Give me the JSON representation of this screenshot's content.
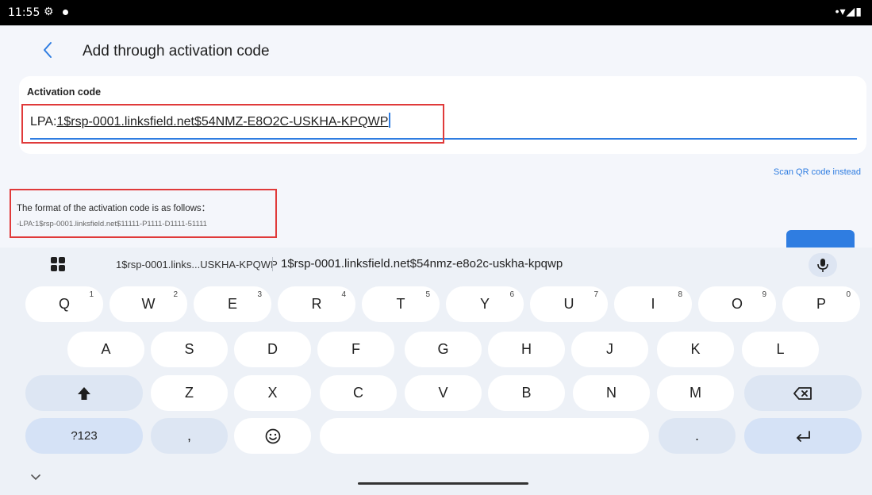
{
  "status_bar": {
    "time": "11:55",
    "settings_icon": "gear-icon",
    "right_icons": "•▾◢▮"
  },
  "header": {
    "title": "Add through activation code",
    "back_icon": "chevron-left-icon"
  },
  "activation": {
    "label": "Activation code",
    "prefix": "LPA:",
    "value_rest": "1$rsp-0001.linksfield.net$54NMZ-E8O2C-USKHA-KPQWP"
  },
  "scan_link": "Scan QR code instead",
  "format": {
    "title": "The format of the activation code is as follows：",
    "example": "-LPA:1$rsp-0001.linksfield.net$11111-P1111-D1111-51111"
  },
  "suggestions": {
    "first": "1$rsp-0001.links...USKHA-KPQWP",
    "second": "1$rsp-0001.linksfield.net$54nmz-e8o2c-uskha-kpqwp"
  },
  "keyboard": {
    "row1": [
      {
        "k": "Q",
        "n": "1"
      },
      {
        "k": "W",
        "n": "2"
      },
      {
        "k": "E",
        "n": "3"
      },
      {
        "k": "R",
        "n": "4"
      },
      {
        "k": "T",
        "n": "5"
      },
      {
        "k": "Y",
        "n": "6"
      },
      {
        "k": "U",
        "n": "7"
      },
      {
        "k": "I",
        "n": "8"
      },
      {
        "k": "O",
        "n": "9"
      },
      {
        "k": "P",
        "n": "0"
      }
    ],
    "row2": [
      "A",
      "S",
      "D",
      "F",
      "G",
      "H",
      "J",
      "K",
      "L"
    ],
    "row3": [
      "Z",
      "X",
      "C",
      "V",
      "B",
      "N",
      "M"
    ],
    "symbols_label": "?123",
    "comma": ",",
    "period": "."
  },
  "colors": {
    "accent": "#2f7de1",
    "highlight_box": "#e03a3a",
    "keyboard_bg": "#edf1f7",
    "function_key": "#d5e2f6"
  }
}
